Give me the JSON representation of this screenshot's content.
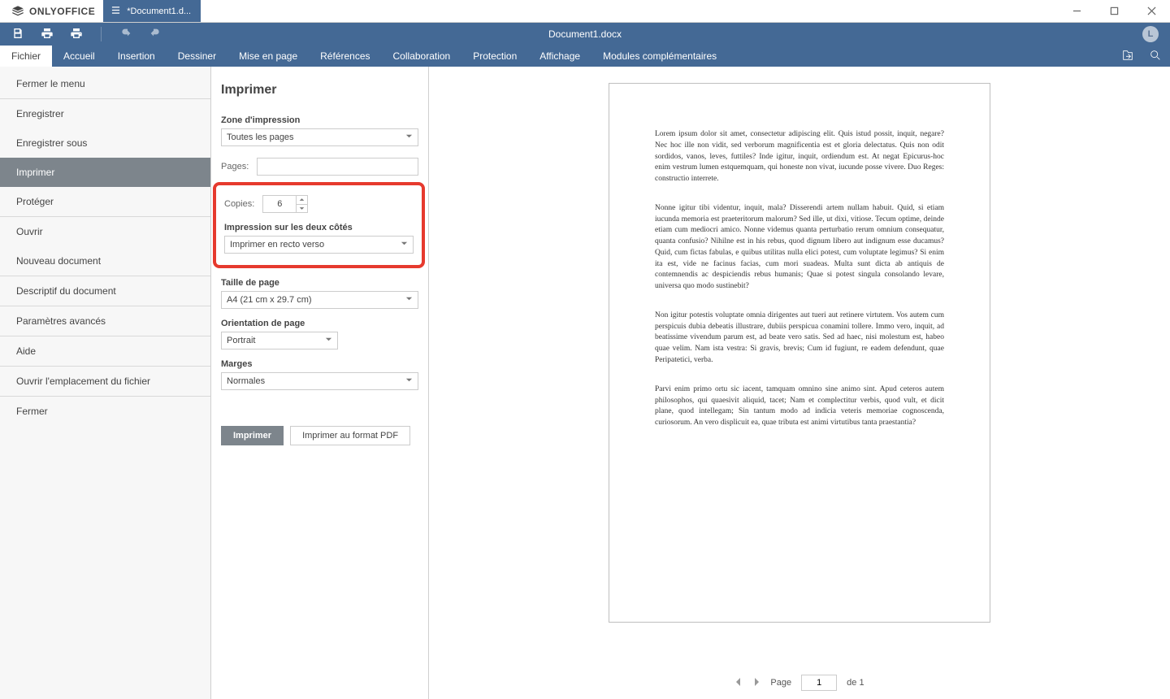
{
  "app": {
    "name": "ONLYOFFICE",
    "doc_tab_title": "*Document1.d..."
  },
  "toolbar_center_title": "Document1.docx",
  "avatar_letter": "L",
  "menubar": {
    "items": [
      "Fichier",
      "Accueil",
      "Insertion",
      "Dessiner",
      "Mise en page",
      "Références",
      "Collaboration",
      "Protection",
      "Affichage",
      "Modules complémentaires"
    ],
    "active_index": 0
  },
  "sidebar": {
    "items": [
      {
        "label": "Fermer le menu"
      },
      {
        "divider": true
      },
      {
        "label": "Enregistrer"
      },
      {
        "label": "Enregistrer sous"
      },
      {
        "label": "Imprimer",
        "selected": true
      },
      {
        "label": "Protéger"
      },
      {
        "divider": true
      },
      {
        "label": "Ouvrir"
      },
      {
        "label": "Nouveau document"
      },
      {
        "divider": true
      },
      {
        "label": "Descriptif du document"
      },
      {
        "divider": true
      },
      {
        "label": "Paramètres avancés"
      },
      {
        "divider": true
      },
      {
        "label": "Aide"
      },
      {
        "divider": true
      },
      {
        "label": "Ouvrir l'emplacement du fichier"
      },
      {
        "divider": true
      },
      {
        "label": "Fermer"
      }
    ]
  },
  "print_panel": {
    "title": "Imprimer",
    "zone_label": "Zone d'impression",
    "zone_value": "Toutes les pages",
    "pages_label": "Pages:",
    "pages_value": "",
    "copies_label": "Copies:",
    "copies_value": "6",
    "duplex_label": "Impression sur les deux côtés",
    "duplex_value": "Imprimer en recto verso",
    "pagesize_label": "Taille de page",
    "pagesize_value": "A4 (21 cm x 29.7 cm)",
    "orientation_label": "Orientation de page",
    "orientation_value": "Portrait",
    "margins_label": "Marges",
    "margins_value": "Normales",
    "btn_print": "Imprimer",
    "btn_print_pdf": "Imprimer au format PDF"
  },
  "preview": {
    "paragraphs": [
      "Lorem ipsum dolor sit amet, consectetur adipiscing elit. Quis istud possit, inquit, negare? Nec hoc ille non vidit, sed verborum magnificentia est et gloria delectatus. Quis non odit sordidos, vanos, leves, futtiles? Inde igitur, inquit, ordiendum est. At negat Epicurus-hoc enim vestrum lumen estquemquam, qui honeste non vivat, iucunde posse vivere. Duo Reges: constructio interrete.",
      "Nonne igitur tibi videntur, inquit, mala? Disserendi artem nullam habuit. Quid, si etiam iucunda memoria est praeteritorum malorum? Sed ille, ut dixi, vitiose. Tecum optime, deinde etiam cum mediocri amico. Nonne videmus quanta perturbatio rerum omnium consequatur, quanta confusio? Nihilne est in his rebus, quod dignum libero aut indignum esse ducamus? Quid, cum fictas fabulas, e quibus utilitas nulla elici potest, cum voluptate legimus? Si enim ita est, vide ne facinus facias, cum mori suadeas. Multa sunt dicta ab antiquis de contemnendis ac despiciendis rebus humanis; Quae si potest singula consolando levare, universa quo modo sustinebit?",
      "Non igitur potestis voluptate omnia dirigentes aut tueri aut retinere virtutem. Vos autem cum perspicuis dubia debeatis illustrare, dubiis perspicua conamini tollere. Immo vero, inquit, ad beatissime vivendum parum est, ad beate vero satis. Sed ad haec, nisi molestum est, habeo quae velim. Nam ista vestra: Si gravis, brevis; Cum id fugiunt, re eadem defendunt, quae Peripatetici, verba.",
      "Parvi enim primo ortu sic iacent, tamquam omnino sine animo sint. Apud ceteros autem philosophos, qui quaesivit aliquid, tacet; Nam et complectitur verbis, quod vult, et dicit plane, quod intellegam; Sin tantum modo ad indicia veteris memoriae cognoscenda, curiosorum. An vero displicuit ea, quae tributa est animi virtutibus tanta praestantia?"
    ],
    "footer": {
      "page_label": "Page",
      "page_current": "1",
      "page_of_label": "de",
      "page_total": "1"
    }
  }
}
